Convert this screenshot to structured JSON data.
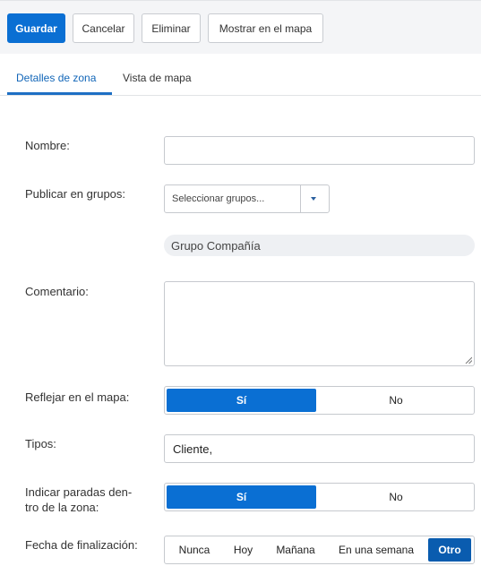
{
  "toolbar": {
    "save": "Guardar",
    "cancel": "Cancelar",
    "delete": "Eliminar",
    "show_on_map": "Mostrar en el mapa"
  },
  "tabs": [
    {
      "label": "Detalles de zona",
      "active": true
    },
    {
      "label": "Vista de mapa",
      "active": false
    }
  ],
  "form": {
    "name": {
      "label": "Nombre:",
      "value": ""
    },
    "publish_groups": {
      "label": "Publicar en grupos:",
      "placeholder": "Seleccionar grupos...",
      "selected_group": "Grupo Compañía"
    },
    "comment": {
      "label": "Comentario:",
      "value": ""
    },
    "show_on_map": {
      "label": "Reflejar en el mapa:",
      "options": [
        "Sí",
        "No"
      ],
      "selected": "Sí"
    },
    "types": {
      "label": "Tipos:",
      "value": "Cliente,"
    },
    "indicate_stops": {
      "label_line1": "Indicar paradas den-",
      "label_line2": "tro de la zona:",
      "options": [
        "Sí",
        "No"
      ],
      "selected": "Sí"
    },
    "end_date": {
      "label": "Fecha de finalización:",
      "options": [
        "Nunca",
        "Hoy",
        "Mañana",
        "En una semana",
        "Otro"
      ],
      "selected": "Otro"
    }
  },
  "colors": {
    "accent": "#0a6fd3",
    "tab_active": "#1266b8"
  }
}
